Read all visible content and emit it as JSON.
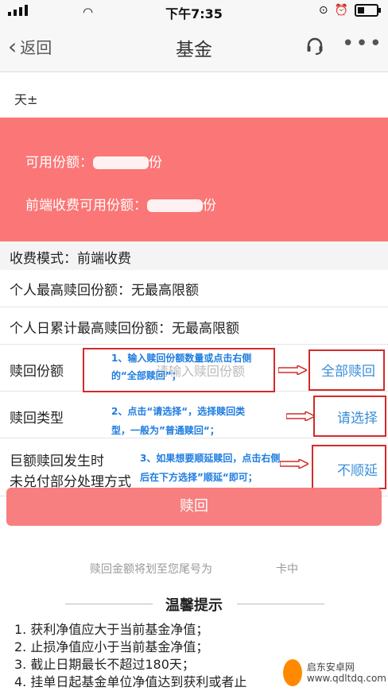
{
  "status": {
    "time": "下午7:35"
  },
  "nav": {
    "back": "返回",
    "title": "基金"
  },
  "account": {
    "text": "天±"
  },
  "shares": {
    "available_label": "可用份额：",
    "available_suffix": "份",
    "front_label": "前端收费可用份额：",
    "front_suffix": "份"
  },
  "fee_mode": {
    "label": "收费模式：",
    "value": "前端收费"
  },
  "personal_max": {
    "label": "个人最高赎回份额：",
    "value": "无最高限额"
  },
  "daily_max": {
    "label": "个人日累计最高赎回份额：",
    "value": "无最高限额"
  },
  "redeem_shares": {
    "label": "赎回份额",
    "placeholder": "请输入赎回份额",
    "all_button": "全部赎回"
  },
  "redeem_type": {
    "label": "赎回类型",
    "select": "请选择"
  },
  "large_redeem": {
    "label_1": "巨额赎回发生时",
    "label_2": "未兑付部分处理方式",
    "value": "不顺延"
  },
  "annotations": {
    "a1_line1": "1、输入赎回份额数量或点击右侧",
    "a1_line2": "的“全部赎回”；",
    "a2_line1": "2、点击“请选择“，选择赎回类",
    "a2_line2": "型，一般为”普通赎回“；",
    "a3_line1": "3、如果想要顺延赎回，点击右侧",
    "a3_line2": "后在下方选择”顺延“即可；"
  },
  "redeem_button": "赎回",
  "note": {
    "prefix": "赎回金额将划至您尾号为",
    "suffix": "卡中"
  },
  "tips": {
    "title": "温馨提示",
    "items": [
      "1.  获利净值应大于当前基金净值；",
      "2.  止损净值应小于当前基金净值；",
      "3.  截止日期最长不超过180天；",
      "4.  挂单日起基金单位净值达到获利或者止"
    ]
  },
  "watermark": {
    "line1": "启东安卓网",
    "line2": "www.qdltdq.com"
  },
  "colors": {
    "pink": "#fb7676",
    "button": "#f77f7f",
    "link": "#3a8fd8",
    "annotation_border": "#d32a2a",
    "annotation_text": "#1f7de0"
  }
}
